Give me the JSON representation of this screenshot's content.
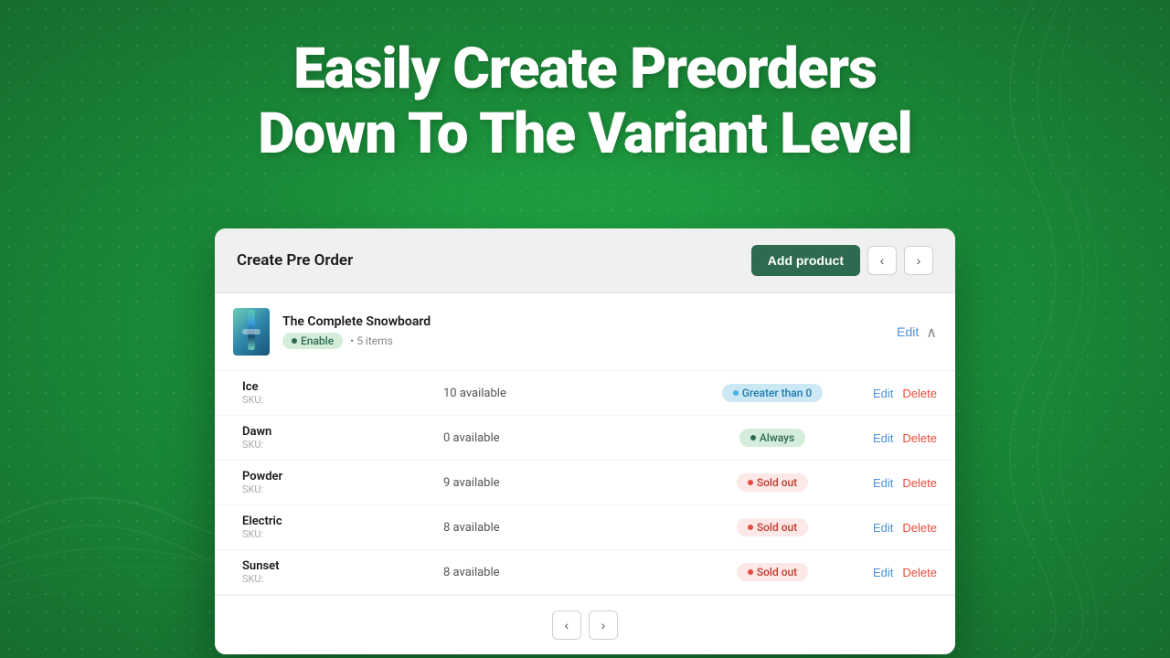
{
  "background": {
    "color": "#1a9e3f"
  },
  "hero": {
    "line1": "Easily Create Preorders",
    "line2": "Down To The Variant Level"
  },
  "card": {
    "title": "Create Pre Order",
    "add_product_label": "Add product",
    "nav_prev": "‹",
    "nav_next": "›"
  },
  "product": {
    "name": "The Complete Snowboard",
    "status_badge": "Enable",
    "items_count": "5 items",
    "edit_label": "Edit",
    "variants": [
      {
        "name": "Ice",
        "sku_label": "SKU:",
        "sku_value": "",
        "stock": "10 available",
        "badge_type": "greater",
        "badge_label": "Greater than 0",
        "edit": "Edit",
        "delete": "Delete"
      },
      {
        "name": "Dawn",
        "sku_label": "SKU:",
        "sku_value": "",
        "stock": "0 available",
        "badge_type": "always",
        "badge_label": "Always",
        "edit": "Edit",
        "delete": "Delete"
      },
      {
        "name": "Powder",
        "sku_label": "SKU:",
        "sku_value": "",
        "stock": "9 available",
        "badge_type": "soldout",
        "badge_label": "Sold out",
        "edit": "Edit",
        "delete": "Delete"
      },
      {
        "name": "Electric",
        "sku_label": "SKU:",
        "sku_value": "",
        "stock": "8 available",
        "badge_type": "soldout",
        "badge_label": "Sold out",
        "edit": "Edit",
        "delete": "Delete"
      },
      {
        "name": "Sunset",
        "sku_label": "SKU:",
        "sku_value": "",
        "stock": "8 available",
        "badge_type": "soldout",
        "badge_label": "Sold out",
        "edit": "Edit",
        "delete": "Delete"
      }
    ]
  },
  "footer": {
    "prev": "‹",
    "next": "›"
  }
}
